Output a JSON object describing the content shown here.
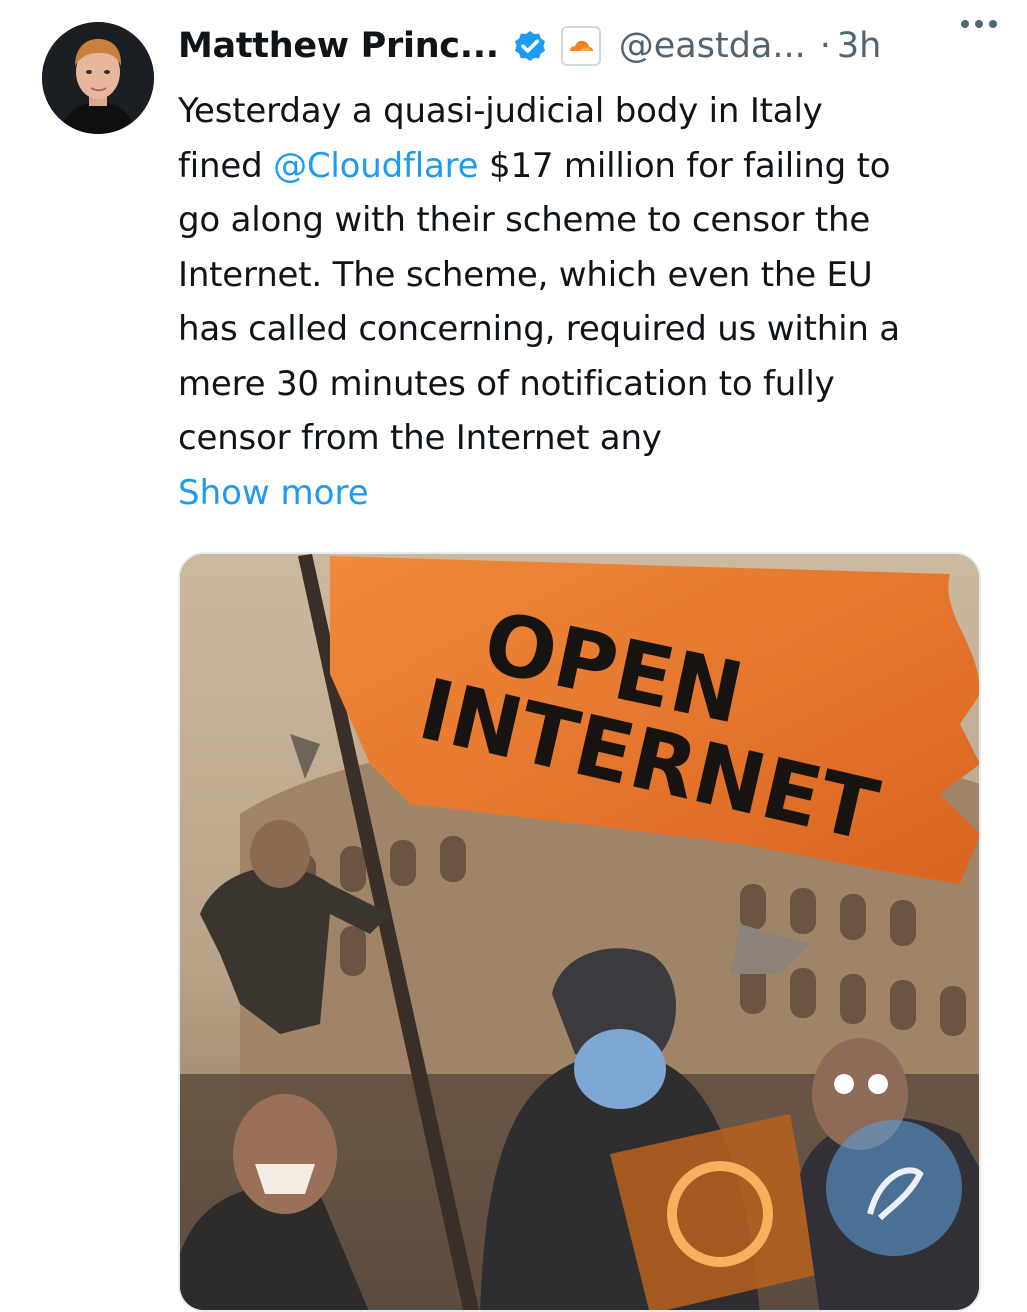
{
  "tweet": {
    "author_name": "Matthew Princ...",
    "handle": "@eastda...",
    "separator": "·",
    "time": "3h",
    "verified": true,
    "affiliation_badge": "cloudflare-logo-icon",
    "more_icon": "more-horizontal-icon",
    "text_lines": [
      "Yesterday a quasi-judicial body in Italy",
      "$17 million for failing to",
      "go along with their scheme to censor the",
      "Internet. The scheme, which even the EU",
      "has called concerning, required us within a",
      "mere 30 minutes of notification to fully",
      "censor from the Internet any"
    ],
    "line2_prefix": "fined ",
    "mention": "@Cloudflare",
    "show_more": "Show more"
  },
  "media": {
    "banner_line1": "OPEN",
    "banner_line2": "INTERNET",
    "watermark_icon": "watermark-logo-icon"
  },
  "colors": {
    "link": "#1d9bf0",
    "verified": "#1d9bf0",
    "banner": "#e0742c",
    "secondary_text": "#536471"
  }
}
